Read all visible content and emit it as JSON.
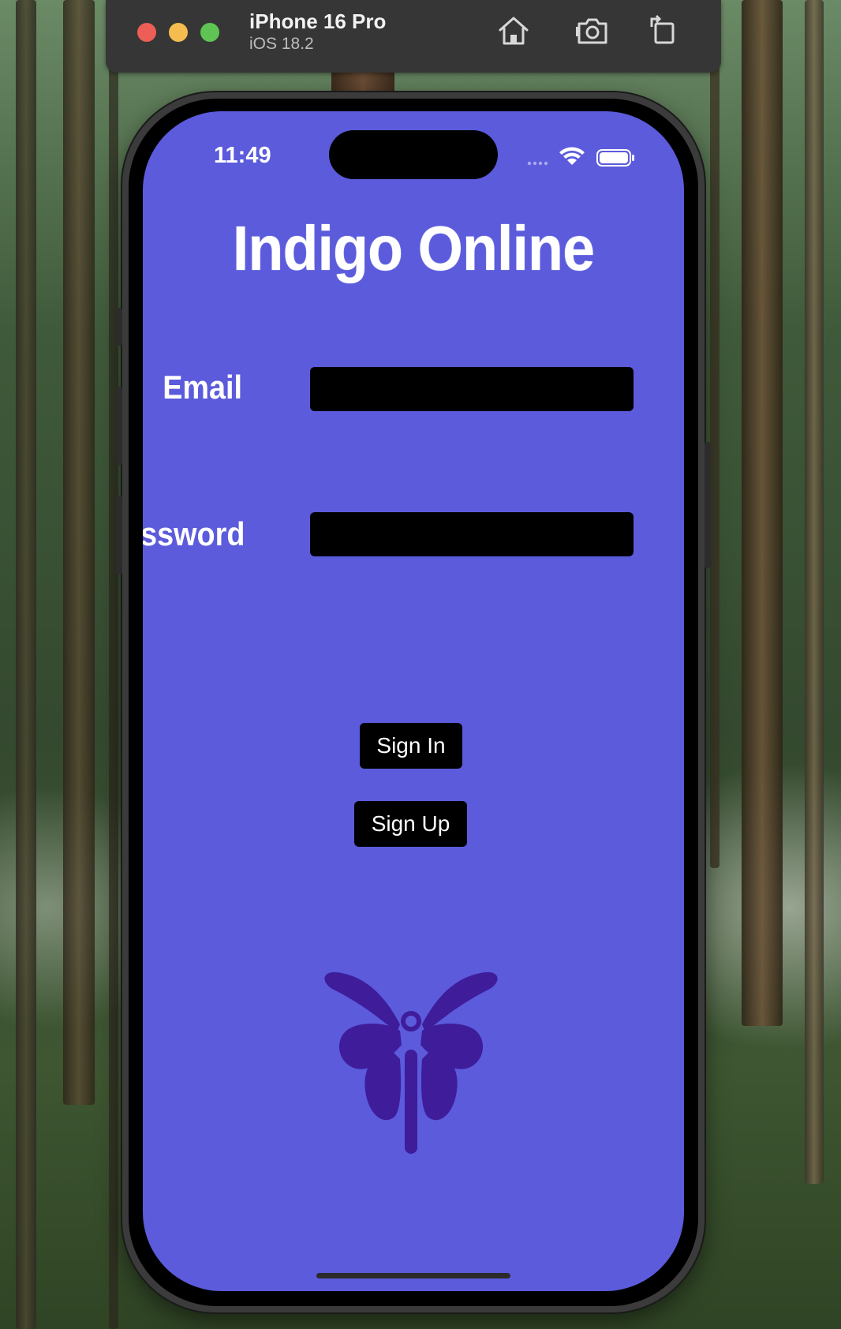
{
  "simulator": {
    "device_name": "iPhone 16 Pro",
    "os_version": "iOS 18.2",
    "toolbar_icons": [
      "home-icon",
      "screenshot-camera-icon",
      "rotate-icon"
    ]
  },
  "status_bar": {
    "time": "11:49",
    "icons": [
      "cellular-signal-icon",
      "wifi-icon",
      "battery-icon"
    ]
  },
  "app": {
    "title": "Indigo Online",
    "email_label": "Email",
    "email_value": "",
    "password_label": "Password",
    "password_value": "",
    "sign_in_label": "Sign In",
    "sign_up_label": "Sign Up",
    "logo_icon": "butterfly-logo-icon"
  },
  "colors": {
    "screen_background": "#5b5bdc",
    "logo": "#3f1c9a",
    "input_background": "#000000",
    "button_background": "#000000"
  }
}
